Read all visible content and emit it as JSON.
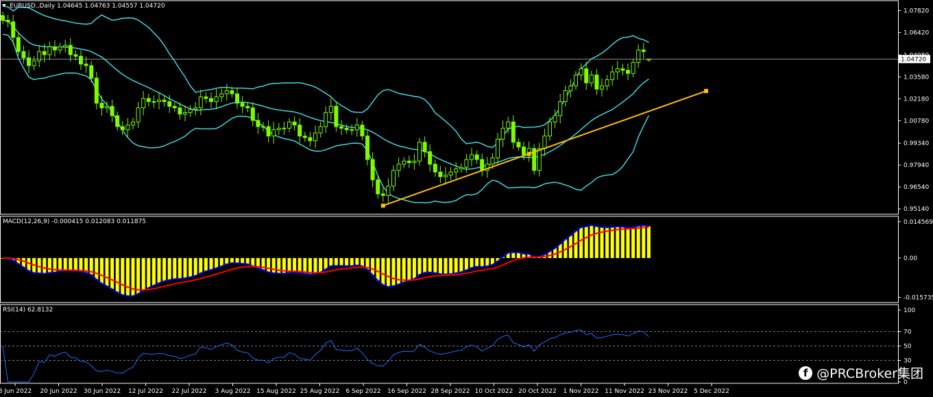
{
  "main_title": "EURUSD.,Daily  1.04645 1.04763 1.04557 1.04720",
  "current_price_label": "1.04720",
  "macd_title": "MACD(12,26,9) -0.000415 0.012083 0.011875",
  "rsi_title": "RSI(14) 62.8132",
  "watermark": "@PRCBroker集团",
  "colors": {
    "bull": "#7CFC00",
    "band": "#40D8E0",
    "trend": "#FFC000",
    "hist": "#FFFF00",
    "macd": "#0000FF",
    "signal": "#FF0000",
    "rsi": "#1E6FFF",
    "grid": "#AAAAAA"
  },
  "chart_data": [
    {
      "type": "candlestick",
      "symbol": "EURUSD.",
      "timeframe": "Daily",
      "ohlc_last": {
        "open": 1.04645,
        "high": 1.04763,
        "low": 1.04557,
        "close": 1.0472
      },
      "y_ticks": [
        "1.07820",
        "1.06420",
        "1.04980",
        "1.03580",
        "1.02180",
        "1.00780",
        "0.99340",
        "0.97940",
        "0.96540",
        "0.95140"
      ],
      "ylim": [
        0.948,
        1.0845
      ],
      "x_ticks": [
        "8 Jun 2022",
        "20 Jun 2022",
        "30 Jun 2022",
        "12 Jul 2022",
        "22 Jul 2022",
        "3 Aug 2022",
        "15 Aug 2022",
        "25 Aug 2022",
        "6 Sep 2022",
        "16 Sep 2022",
        "28 Sep 2022",
        "10 Oct 2022",
        "20 Oct 2022",
        "1 Nov 2022",
        "11 Nov 2022",
        "23 Nov 2022",
        "5 Dec 2022"
      ],
      "close": [
        1.072,
        1.071,
        1.061,
        1.052,
        1.048,
        1.043,
        1.046,
        1.052,
        1.05,
        1.055,
        1.053,
        1.055,
        1.056,
        1.05,
        1.049,
        1.044,
        1.043,
        1.035,
        1.019,
        1.016,
        1.017,
        1.011,
        1.004,
        1.002,
        1.005,
        1.007,
        1.016,
        1.022,
        1.02,
        1.02,
        1.021,
        1.02,
        1.017,
        1.016,
        1.012,
        1.013,
        1.015,
        1.016,
        1.023,
        1.022,
        1.02,
        1.023,
        1.025,
        1.027,
        1.025,
        1.019,
        1.017,
        1.016,
        1.008,
        1.004,
        1.004,
        0.998,
        1.002,
        1.003,
        1.003,
        1.007,
        1.005,
        0.998,
        0.997,
        0.995,
        1.0,
        1.004,
        1.013,
        1.017,
        1.004,
        1.003,
        1.002,
        1.002,
        1.005,
        0.998,
        0.983,
        0.97,
        0.961,
        0.96,
        0.966,
        0.976,
        0.98,
        0.982,
        0.981,
        0.982,
        0.994,
        0.988,
        0.98,
        0.975,
        0.972,
        0.973,
        0.975,
        0.977,
        0.978,
        0.983,
        0.986,
        0.983,
        0.976,
        0.98,
        0.984,
        0.996,
        1.003,
        1.007,
        0.994,
        0.991,
        0.986,
        0.99,
        0.976,
        0.99,
        0.998,
        1.007,
        1.011,
        1.02,
        1.027,
        1.03,
        1.037,
        1.041,
        1.032,
        1.037,
        1.028,
        1.03,
        1.034,
        1.039,
        1.041,
        1.04,
        1.038,
        1.045,
        1.053,
        1.052,
        1.047
      ],
      "bollinger": {
        "period": 20
      },
      "trendline": {
        "from": {
          "index": 73,
          "price": 0.9535
        },
        "through": {
          "index": 101,
          "price": 0.9866
        },
        "to_index": 135
      }
    },
    {
      "type": "macd",
      "params": [
        12,
        26,
        9
      ],
      "values": {
        "histogram": -0.000415,
        "macd": 0.012083,
        "signal": 0.011875
      },
      "y_ticks": [
        "0.014569",
        "0.00",
        "-0.015735"
      ],
      "ylim": [
        -0.0178,
        0.0167
      ]
    },
    {
      "type": "rsi",
      "period": 14,
      "value": 62.8132,
      "y_ticks": [
        "100",
        "70",
        "50",
        "30",
        "0"
      ],
      "levels": [
        70,
        50,
        30
      ],
      "ylim": [
        0,
        100
      ]
    }
  ]
}
